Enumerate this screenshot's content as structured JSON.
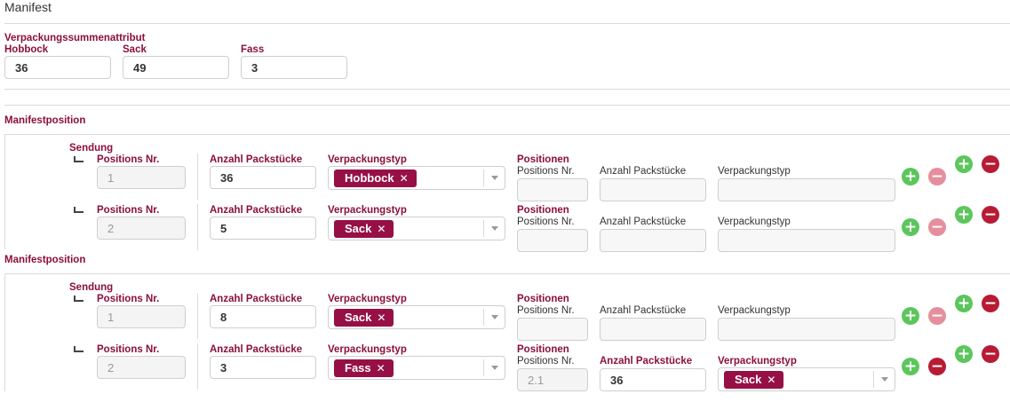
{
  "title": "Manifest",
  "summary": {
    "heading": "Verpackungssummenattribut",
    "fields": [
      {
        "label": "Hobbock",
        "value": "36"
      },
      {
        "label": "Sack",
        "value": "49"
      },
      {
        "label": "Fass",
        "value": "3"
      }
    ]
  },
  "labels": {
    "manifestposition": "Manifestposition",
    "sendung": "Sendung",
    "positions_nr": "Positions Nr.",
    "anzahl": "Anzahl Packstücke",
    "verpackungstyp": "Verpackungstyp",
    "positionen": "Positionen"
  },
  "manifestpositions": [
    {
      "rows": [
        {
          "pos": "1",
          "anzahl": "36",
          "typ": "Hobbock",
          "sub_pos": "",
          "sub_anzahl": "",
          "sub_typ": ""
        },
        {
          "pos": "2",
          "anzahl": "5",
          "typ": "Sack",
          "sub_pos": "",
          "sub_anzahl": "",
          "sub_typ": ""
        }
      ]
    },
    {
      "rows": [
        {
          "pos": "1",
          "anzahl": "8",
          "typ": "Sack",
          "sub_pos": "",
          "sub_anzahl": "",
          "sub_typ": ""
        },
        {
          "pos": "2",
          "anzahl": "3",
          "typ": "Fass",
          "sub_pos": "2.1",
          "sub_anzahl": "36",
          "sub_typ": "Sack"
        }
      ]
    }
  ],
  "icons": {
    "add": "+",
    "remove": "−",
    "tag_remove": "✕"
  },
  "colors": {
    "accent": "#8b0f3c",
    "tag": "#961046",
    "add": "#5cc65c",
    "remove": "#b71c34",
    "remove_disabled": "#e58f9e"
  }
}
